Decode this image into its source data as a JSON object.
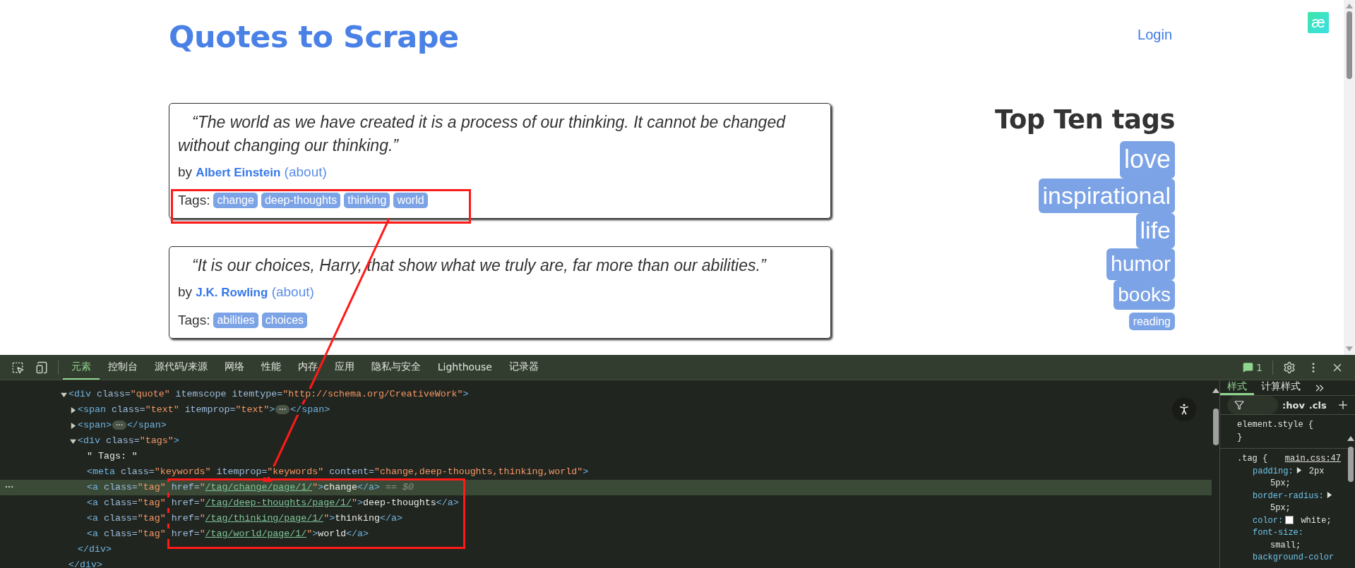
{
  "page": {
    "title": "Quotes to Scrape",
    "login": "Login",
    "extension_badge": "æ",
    "quotes": [
      {
        "text": "“The world as we have created it is a process of our thinking. It cannot be changed without changing our thinking.”",
        "by": "by",
        "author": "Albert Einstein",
        "about": "(about)",
        "tags_label": "Tags:",
        "tags": [
          "change",
          "deep-thoughts",
          "thinking",
          "world"
        ]
      },
      {
        "text": "“It is our choices, Harry, that show what we truly are, far more than our abilities.”",
        "by": "by",
        "author": "J.K. Rowling",
        "about": "(about)",
        "tags_label": "Tags:",
        "tags": [
          "abilities",
          "choices"
        ]
      }
    ],
    "top_tags": {
      "title": "Top Ten tags",
      "tags": [
        "love",
        "inspirational",
        "life",
        "humor",
        "books",
        "reading"
      ]
    }
  },
  "devtools": {
    "tabs": [
      {
        "label": "元素",
        "selected": true
      },
      {
        "label": "控制台",
        "selected": false
      },
      {
        "label": "源代码/来源",
        "selected": false
      },
      {
        "label": "网络",
        "selected": false
      },
      {
        "label": "性能",
        "selected": false
      },
      {
        "label": "内存",
        "selected": false
      },
      {
        "label": "应用",
        "selected": false
      },
      {
        "label": "隐私与安全",
        "selected": false
      },
      {
        "label": "Lighthouse",
        "selected": false
      },
      {
        "label": "记录器",
        "selected": false
      }
    ],
    "issues_count": "1",
    "dom_tree": [
      {
        "kind": "container",
        "expanded": true,
        "selected": false,
        "open": [
          {
            "kind": "tag",
            "text": "<div"
          },
          {
            "kind": "attr",
            "text": " class="
          },
          {
            "kind": "value",
            "text": "\"quote\""
          },
          {
            "kind": "attr",
            "text": " itemscope itemtype="
          },
          {
            "kind": "value",
            "text": "\"http://schema.org/CreativeWork\""
          },
          {
            "kind": "tag",
            "text": ">"
          }
        ],
        "close": [
          {
            "kind": "tag",
            "text": "</div>"
          }
        ],
        "children": [
          {
            "kind": "container",
            "expanded": false,
            "selected": false,
            "open": [
              {
                "kind": "tag",
                "text": "<span"
              },
              {
                "kind": "attr",
                "text": " class="
              },
              {
                "kind": "value",
                "text": "\"text\""
              },
              {
                "kind": "attr",
                "text": " itemprop="
              },
              {
                "kind": "value",
                "text": "\"text\""
              },
              {
                "kind": "tag",
                "text": ">"
              }
            ],
            "close": [
              {
                "kind": "tag",
                "text": "</span>"
              }
            ]
          },
          {
            "kind": "container",
            "expanded": false,
            "selected": false,
            "open": [
              {
                "kind": "tag",
                "text": "<span>"
              }
            ],
            "close": [
              {
                "kind": "tag",
                "text": "</span>"
              }
            ]
          },
          {
            "kind": "container",
            "expanded": true,
            "selected": false,
            "open": [
              {
                "kind": "tag",
                "text": "<div"
              },
              {
                "kind": "attr",
                "text": " class="
              },
              {
                "kind": "value",
                "text": "\"tags\""
              },
              {
                "kind": "tag",
                "text": ">"
              }
            ],
            "close": [
              {
                "kind": "tag",
                "text": "</div>"
              }
            ],
            "children": [
              {
                "kind": "leaf",
                "selected": false,
                "segments": [
                  {
                    "kind": "text",
                    "text": "\" Tags: \""
                  }
                ]
              },
              {
                "kind": "leaf",
                "selected": false,
                "segments": [
                  {
                    "kind": "tag",
                    "text": "<meta"
                  },
                  {
                    "kind": "attr",
                    "text": " class="
                  },
                  {
                    "kind": "value",
                    "text": "\"keywords\""
                  },
                  {
                    "kind": "attr",
                    "text": " itemprop="
                  },
                  {
                    "kind": "value",
                    "text": "\"keywords\""
                  },
                  {
                    "kind": "attr",
                    "text": " content="
                  },
                  {
                    "kind": "value",
                    "text": "\"change,deep-thoughts,thinking,world\""
                  },
                  {
                    "kind": "tag",
                    "text": ">"
                  }
                ]
              },
              {
                "kind": "leaf",
                "selected": true,
                "segments": [
                  {
                    "kind": "tag",
                    "text": "<a"
                  },
                  {
                    "kind": "attr",
                    "text": " class="
                  },
                  {
                    "kind": "value",
                    "text": "\"tag\""
                  },
                  {
                    "kind": "attr",
                    "text": " href="
                  },
                  {
                    "kind": "value",
                    "text": "\""
                  },
                  {
                    "kind": "link",
                    "text": "/tag/change/page/1/"
                  },
                  {
                    "kind": "value",
                    "text": "\""
                  },
                  {
                    "kind": "tag",
                    "text": ">"
                  },
                  {
                    "kind": "text",
                    "text": "change"
                  },
                  {
                    "kind": "tag",
                    "text": "</a>"
                  },
                  {
                    "kind": "marker",
                    "text": " == $0"
                  }
                ]
              },
              {
                "kind": "leaf",
                "selected": false,
                "segments": [
                  {
                    "kind": "tag",
                    "text": "<a"
                  },
                  {
                    "kind": "attr",
                    "text": " class="
                  },
                  {
                    "kind": "value",
                    "text": "\"tag\""
                  },
                  {
                    "kind": "attr",
                    "text": " href="
                  },
                  {
                    "kind": "value",
                    "text": "\""
                  },
                  {
                    "kind": "link",
                    "text": "/tag/deep-thoughts/page/1/"
                  },
                  {
                    "kind": "value",
                    "text": "\""
                  },
                  {
                    "kind": "tag",
                    "text": ">"
                  },
                  {
                    "kind": "text",
                    "text": "deep-thoughts"
                  },
                  {
                    "kind": "tag",
                    "text": "</a>"
                  }
                ]
              },
              {
                "kind": "leaf",
                "selected": false,
                "segments": [
                  {
                    "kind": "tag",
                    "text": "<a"
                  },
                  {
                    "kind": "attr",
                    "text": " class="
                  },
                  {
                    "kind": "value",
                    "text": "\"tag\""
                  },
                  {
                    "kind": "attr",
                    "text": " href="
                  },
                  {
                    "kind": "value",
                    "text": "\""
                  },
                  {
                    "kind": "link",
                    "text": "/tag/thinking/page/1/"
                  },
                  {
                    "kind": "value",
                    "text": "\""
                  },
                  {
                    "kind": "tag",
                    "text": ">"
                  },
                  {
                    "kind": "text",
                    "text": "thinking"
                  },
                  {
                    "kind": "tag",
                    "text": "</a>"
                  }
                ]
              },
              {
                "kind": "leaf",
                "selected": false,
                "segments": [
                  {
                    "kind": "tag",
                    "text": "<a"
                  },
                  {
                    "kind": "attr",
                    "text": " class="
                  },
                  {
                    "kind": "value",
                    "text": "\"tag\""
                  },
                  {
                    "kind": "attr",
                    "text": " href="
                  },
                  {
                    "kind": "value",
                    "text": "\""
                  },
                  {
                    "kind": "link",
                    "text": "/tag/world/page/1/"
                  },
                  {
                    "kind": "value",
                    "text": "\""
                  },
                  {
                    "kind": "tag",
                    "text": ">"
                  },
                  {
                    "kind": "text",
                    "text": "world"
                  },
                  {
                    "kind": "tag",
                    "text": "</a>"
                  }
                ]
              }
            ]
          }
        ]
      }
    ],
    "styles": {
      "tabs": [
        {
          "label": "样式",
          "selected": true
        },
        {
          "label": "计算样式",
          "selected": false
        }
      ],
      "filter_buttons": [
        ":hov",
        ".cls"
      ],
      "rules": [
        {
          "selector": "element.style {",
          "close": "}"
        },
        {
          "selector": ".tag {",
          "source": "main.css:47",
          "declarations": [
            {
              "property": "padding:",
              "value": "2px 5px;",
              "expandable": true
            },
            {
              "property": "border-radius:",
              "value": "5px;",
              "expandable": true
            },
            {
              "property": "color:",
              "value": "white;",
              "expandable": false,
              "swatch": true
            },
            {
              "property": "font-size:",
              "value": "small;",
              "expandable": false
            },
            {
              "property": "background-color",
              "expandable": false
            }
          ]
        }
      ]
    }
  }
}
